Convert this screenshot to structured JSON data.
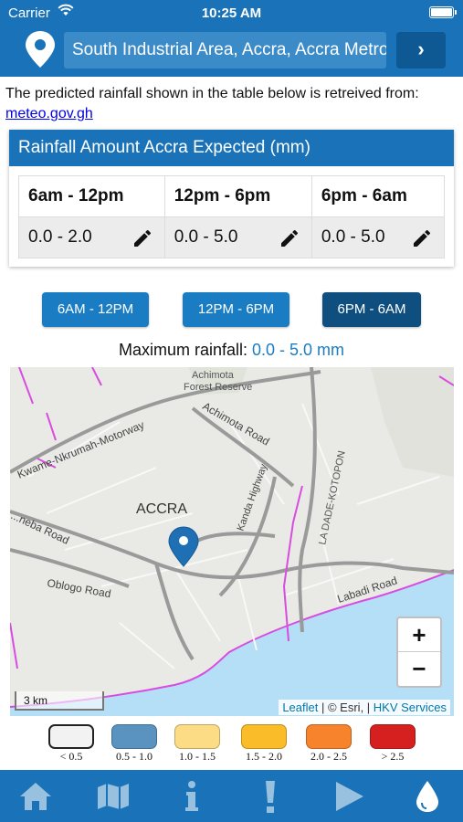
{
  "status_bar": {
    "carrier": "Carrier",
    "time": "10:25 AM"
  },
  "header": {
    "location_value": "South Industrial Area, Accra, Accra Metropolitan",
    "go_label": "›"
  },
  "intro": {
    "text": "The predicted rainfall shown in the table below is retreived from:",
    "link": "meteo.gov.gh"
  },
  "rainfall_card": {
    "title": "Rainfall Amount Accra Expected (mm)",
    "columns": [
      "6am - 12pm",
      "12pm - 6pm",
      "6pm - 6am"
    ],
    "values": [
      "0.0 - 2.0",
      "0.0 - 5.0",
      "0.0 - 5.0"
    ]
  },
  "period_buttons": [
    "6AM - 12PM",
    "12PM - 6PM",
    "6PM - 6AM"
  ],
  "selected_period": "6PM - 6AM",
  "max_rainfall": {
    "label": "Maximum rainfall: ",
    "value": "0.0 - 5.0 mm"
  },
  "map": {
    "labels": {
      "forest": "Achimota\nForest Reserve",
      "motorway": "Kwame-Nkrumah-Motorway",
      "achimota_road": "Achimota Road",
      "kotopon": "LA DADE-KOTOPON",
      "accra": "ACCRA",
      "kanda": "Kanda Highway",
      "ring_road": "...neba Road",
      "oblogo": "Oblogo Road",
      "labadi": "Labadi Road"
    },
    "zoom_in": "+",
    "zoom_out": "−",
    "scale": "3 km",
    "attribution": {
      "leaflet": "Leaflet",
      "esri": "© Esri,",
      "hkv": "HKV Services"
    }
  },
  "legend": [
    {
      "label": "< 0.5",
      "color": "#f2f2f2"
    },
    {
      "label": "0.5 - 1.0",
      "color": "#5a93c0"
    },
    {
      "label": "1.0 - 1.5",
      "color": "#fcdc84"
    },
    {
      "label": "1.5 - 2.0",
      "color": "#fbbc2a"
    },
    {
      "label": "2.0 - 2.5",
      "color": "#f7832c"
    },
    {
      "label": "> 2.5",
      "color": "#d6201f"
    }
  ],
  "tabs": [
    "home-icon",
    "map-icon",
    "info-icon",
    "alert-icon",
    "play-icon",
    "drop-icon"
  ],
  "colors": {
    "primary": "#1a73b8",
    "selected": "#0f4f80",
    "accent": "#1a7dc4"
  }
}
